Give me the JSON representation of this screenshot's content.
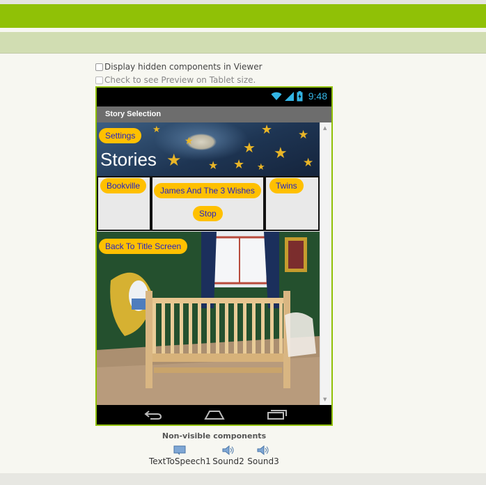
{
  "options": {
    "display_hidden": "Display hidden components in Viewer",
    "tablet_preview": "Check to see Preview on Tablet size."
  },
  "phone": {
    "time": "9:48",
    "screen_title": "Story Selection",
    "buttons": {
      "settings": "Settings",
      "bookville": "Bookville",
      "james": "James And The 3 Wishes",
      "stop": "Stop",
      "twins": "Twins",
      "back": "Back To Title Screen"
    },
    "stories_label": "Stories"
  },
  "non_visible": {
    "title": "Non-visible components",
    "items": [
      {
        "label": "TextToSpeech1",
        "icon": "text-to-speech-icon"
      },
      {
        "label": "Sound2",
        "icon": "speaker-icon"
      },
      {
        "label": "Sound3",
        "icon": "speaker-icon"
      }
    ]
  },
  "colors": {
    "header_green": "#90c106",
    "button_yellow": "#ffc000",
    "button_text": "#2323c4",
    "time_blue": "#33b5e5"
  }
}
